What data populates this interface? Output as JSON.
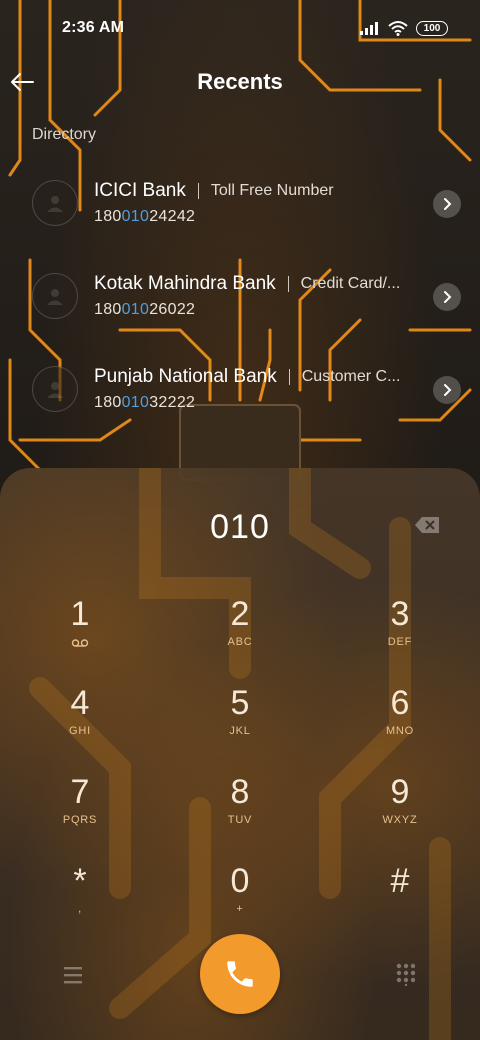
{
  "status_bar": {
    "time": "2:36 AM",
    "battery": "100"
  },
  "header": {
    "title": "Recents"
  },
  "section": {
    "label": "Directory"
  },
  "contacts": [
    {
      "name": "ICICI Bank",
      "description": "Toll Free Number",
      "number_pre": "180",
      "number_match": "010",
      "number_post": "24242"
    },
    {
      "name": "Kotak Mahindra Bank",
      "description": "Credit Card/...",
      "number_pre": "180",
      "number_match": "010",
      "number_post": "26022"
    },
    {
      "name": "Punjab National Bank",
      "description": "Customer C...",
      "number_pre": "180",
      "number_match": "010",
      "number_post": "32222"
    }
  ],
  "dialer": {
    "input": "010",
    "keys": [
      {
        "digit": "1",
        "sub": "voicemail"
      },
      {
        "digit": "2",
        "sub": "ABC"
      },
      {
        "digit": "3",
        "sub": "DEF"
      },
      {
        "digit": "4",
        "sub": "GHI"
      },
      {
        "digit": "5",
        "sub": "JKL"
      },
      {
        "digit": "6",
        "sub": "MNO"
      },
      {
        "digit": "7",
        "sub": "PQRS"
      },
      {
        "digit": "8",
        "sub": "TUV"
      },
      {
        "digit": "9",
        "sub": "WXYZ"
      },
      {
        "digit": "*",
        "sub": ","
      },
      {
        "digit": "0",
        "sub": "+"
      },
      {
        "digit": "#",
        "sub": ""
      }
    ]
  },
  "colors": {
    "accent": "#f39a2c",
    "match_highlight": "#4f9fe0",
    "circuit": "#ff9a1a"
  }
}
